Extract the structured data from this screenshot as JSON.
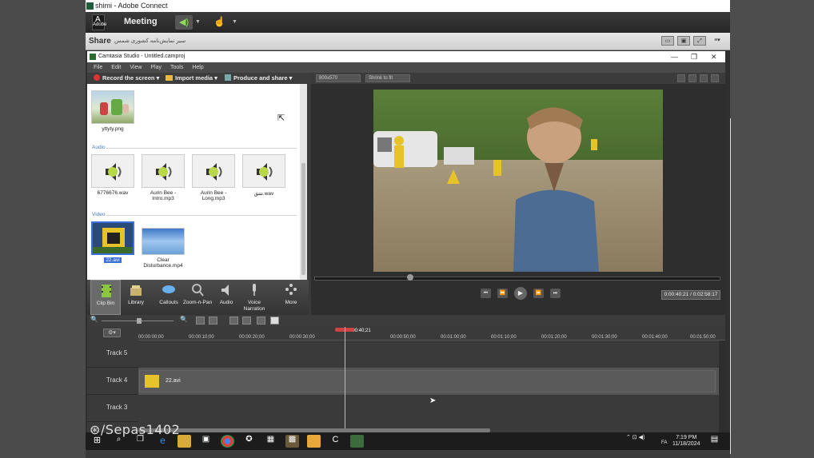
{
  "window": {
    "title": "shimi - Adobe Connect"
  },
  "connect": {
    "logo": "Adobe",
    "menu_label": "Meeting",
    "share_title": "Share",
    "share_subtitle": "سیر نمایش‌نامه کشوری شمس"
  },
  "camtasia": {
    "title": "Camtasia Studio - Untitled.camproj",
    "menu": [
      "File",
      "Edit",
      "View",
      "Play",
      "Tools",
      "Help"
    ],
    "toolbar": {
      "record": "Record the screen",
      "import": "Import media",
      "produce": "Produce and share"
    },
    "bin": {
      "images": [
        {
          "caption": "yttyty.png"
        }
      ],
      "audio_label": "Audio",
      "audio": [
        {
          "caption": "6776676.wav"
        },
        {
          "caption": "Aurin Bee - Intro.mp3"
        },
        {
          "caption": "Aurin Bee - Long.mp3"
        },
        {
          "caption": "تتتق.wav"
        }
      ],
      "video_label": "Video",
      "video": [
        {
          "caption": "22.avi"
        },
        {
          "caption": "Clear Disturbance.mp4"
        }
      ]
    },
    "tabs": [
      {
        "label": "Clip Bin",
        "icon": "film-strip-icon"
      },
      {
        "label": "Library",
        "icon": "library-icon"
      },
      {
        "label": "Callouts",
        "icon": "callout-icon"
      },
      {
        "label": "Zoom-n-Pan",
        "icon": "zoom-icon"
      },
      {
        "label": "Audio",
        "icon": "speaker-icon"
      },
      {
        "label": "Voice Narration",
        "icon": "microphone-icon"
      },
      {
        "label": "More",
        "icon": "more-icon"
      }
    ],
    "preview": {
      "size_field": "800x570",
      "shrink_field": "Shrink to fit",
      "timecode": "0:00:40:21 / 0:02:58:17"
    },
    "timeline": {
      "ticks": [
        "00:00:00;00",
        "00:00:10;00",
        "00:00:20;00",
        "00:00:30;00",
        "00:00:40;21",
        "00:00:50;00",
        "00:01:00;00",
        "00:01:10;00",
        "00:01:20;00",
        "00:01:30;00",
        "00:01:40;00",
        "00:01:50;00"
      ],
      "tracks": [
        {
          "label": "Track 5",
          "clip": ""
        },
        {
          "label": "Track 4",
          "clip": "22.avi"
        },
        {
          "label": "Track 3",
          "clip": ""
        }
      ]
    }
  },
  "taskbar": {
    "lang": "FA",
    "time": "7:19 PM",
    "date": "11/18/2024"
  },
  "watermark": "/Sepas1402"
}
